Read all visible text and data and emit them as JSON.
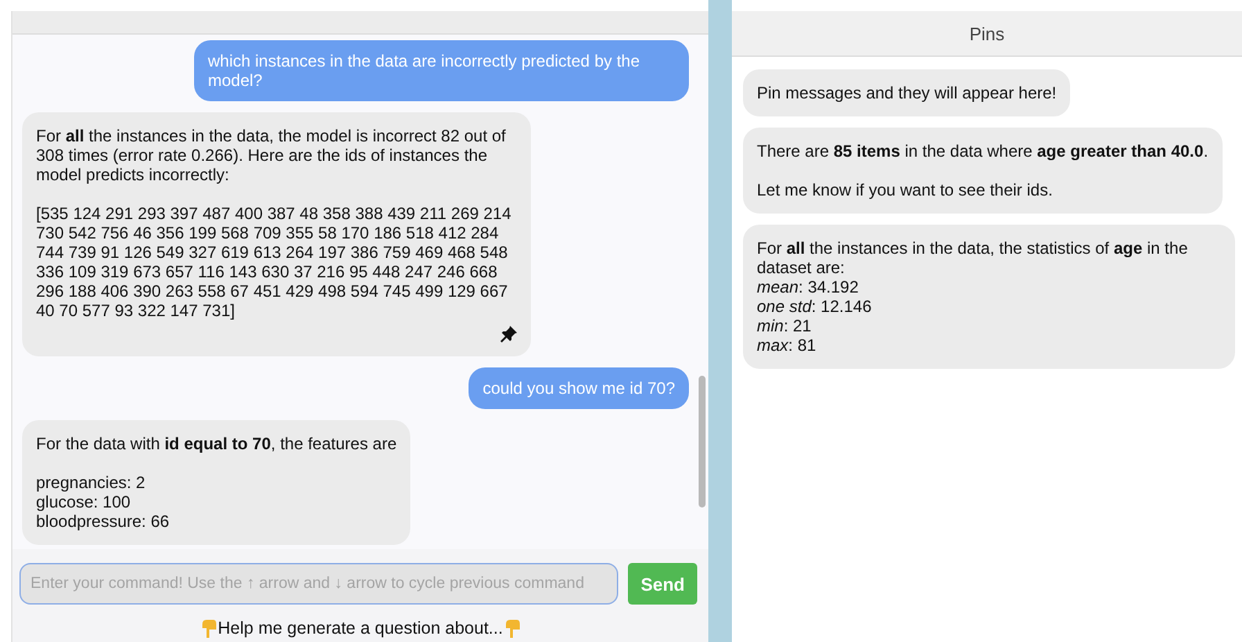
{
  "chat": {
    "messages": [
      {
        "kind": "user",
        "paragraphs": [
          [
            "which instances in the data are incorrectly predicted by the model?"
          ]
        ],
        "pinnable": false
      },
      {
        "kind": "bot",
        "paragraphs": [
          [
            "For **all** the instances in the data, the model is incorrect 82 out of 308 times (error rate 0.266). Here are the ids of instances the model predicts incorrectly:"
          ],
          [
            "[535 124 291 293 397 487 400 387 48 358 388 439 211 269 214 730 542 756 46 356 199 568 709 355 58 170 186 518 412 284 744 739 91 126 549 327 619 613 264 197 386 759 469 468 548 336 109 319 673 657 116 143 630 37 216 95 448 247 246 668 296 188 406 390 263 558 67 451 429 498 594 745 499 129 667 40 70 577 93 322 147 731]"
          ]
        ],
        "pinnable": true
      },
      {
        "kind": "user",
        "paragraphs": [
          [
            "could you show me id 70?"
          ]
        ],
        "pinnable": false
      },
      {
        "kind": "bot",
        "paragraphs": [
          [
            "For the data with **id equal to 70**, the features are"
          ],
          [
            "pregnancies: 2",
            "glucose: 100",
            "bloodpressure: 66"
          ]
        ],
        "pinnable": false
      }
    ],
    "input": {
      "placeholder": "Enter your command! Use the ↑ arrow and ↓ arrow to cycle previous command"
    },
    "send_button": "Send",
    "help_button": "Help me generate a question about..."
  },
  "pins": {
    "title": "Pins",
    "messages": [
      {
        "paragraphs": [
          [
            "Pin messages and they will appear here!"
          ]
        ]
      },
      {
        "paragraphs": [
          [
            "There are **85 items** in the data where **age greater than 40.0**."
          ],
          [
            "Let me know if you want to see their ids."
          ]
        ]
      },
      {
        "paragraphs": [
          [
            "For **all** the instances in the data, the statistics of **age** in the dataset are:",
            "*mean*: 34.192",
            "*one std*: 12.146",
            "*min*: 21",
            "*max*: 81"
          ]
        ]
      }
    ]
  }
}
